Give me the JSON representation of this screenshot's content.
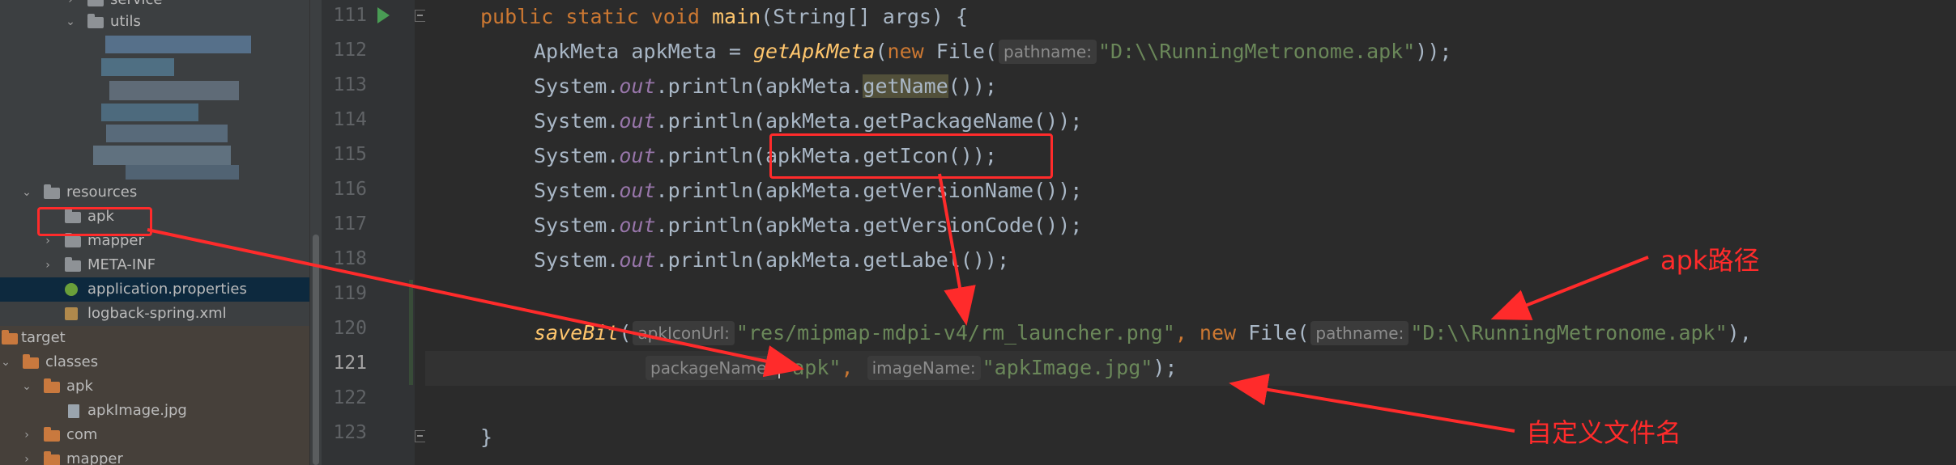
{
  "tree": {
    "service": "service",
    "utils": "utils",
    "resources": "resources",
    "apk": "apk",
    "mapper": "mapper",
    "meta_inf": "META-INF",
    "application_properties": "application.properties",
    "logback": "logback-spring.xml",
    "target": "target",
    "classes": "classes",
    "apk2": "apk",
    "apkImage": "apkImage.jpg",
    "com": "com",
    "mapper2": "mapper"
  },
  "line_numbers": [
    "111",
    "112",
    "113",
    "114",
    "115",
    "116",
    "117",
    "118",
    "119",
    "120",
    "121",
    "122",
    "123"
  ],
  "code": {
    "l111": {
      "public": "public ",
      "static": "static ",
      "void": "void ",
      "main": "main",
      "rest": "(String[] args) {"
    },
    "l112": {
      "a": "ApkMeta apkMeta = ",
      "fn": "getApkMeta",
      "b": "(",
      "new": "new ",
      "c": "File(",
      "hint": "pathname:",
      "str": "\"D:\\\\RunningMetronome.apk\"",
      "d": "));"
    },
    "l113": {
      "sys": "System.",
      "out": "out",
      "pr": ".println(apkMeta.",
      "m": "getName",
      "end": "());"
    },
    "l114": {
      "sys": "System.",
      "out": "out",
      "pr": ".println(apkMeta.getPackageName());"
    },
    "l115": {
      "sys": "System.",
      "out": "out",
      "pr": ".println(apkMeta.getIcon());"
    },
    "l116": {
      "sys": "System.",
      "out": "out",
      "pr": ".println(apkMeta.getVersionName());"
    },
    "l117": {
      "sys": "System.",
      "out": "out",
      "pr": ".println(apkMeta.getVersionCode());"
    },
    "l118": {
      "sys": "System.",
      "out": "out",
      "pr": ".println(apkMeta.getLabel());"
    },
    "l120": {
      "fn": "saveBit",
      "a": "(",
      "hint1": "apkIconUrl:",
      "str1": "\"res/mipmap-mdpi-v4/rm_launcher.png\"",
      "b": ", ",
      "new": "new ",
      "c": "File(",
      "hint2": "pathname:",
      "str2": "\"D:\\\\RunningMetronome.apk\"",
      "d": "),"
    },
    "l121": {
      "hint1": "packageName:",
      "str1": "\"apk\"",
      "a": ", ",
      "hint2": "imageName:",
      "str2": "\"apkImage.jpg\"",
      "b": ");"
    },
    "l123": {
      "brace": "}"
    }
  },
  "annotations": {
    "apk_path": "apk路径",
    "custom_filename": "自定义文件名",
    "color": "#ff2b2b"
  }
}
